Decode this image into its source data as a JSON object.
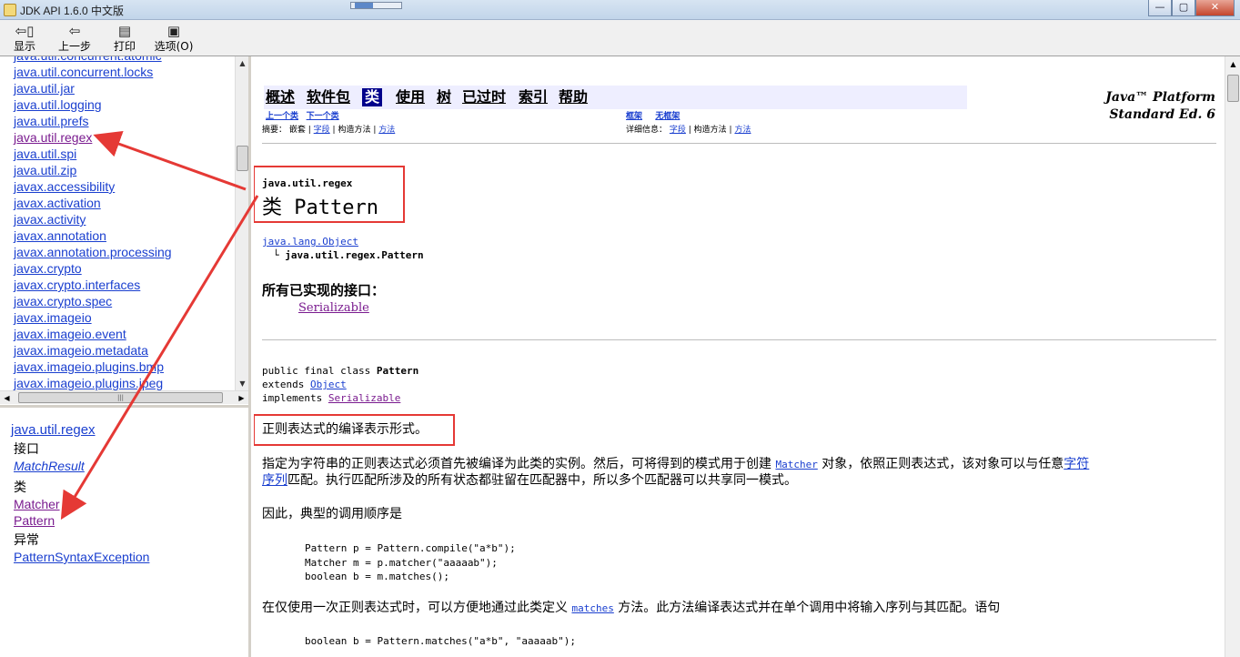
{
  "window": {
    "title": "JDK API 1.6.0 中文版",
    "buttons": {
      "minimize": "—",
      "maximize": "▢",
      "close": "✕"
    }
  },
  "toolbar": {
    "show": "显示",
    "back": "上一步",
    "print": "打印",
    "options": "选项(O)"
  },
  "package_list": {
    "partial_top": "java.util.concurrent.atomic",
    "items": [
      "java.util.concurrent.locks",
      "java.util.jar",
      "java.util.logging",
      "java.util.prefs",
      "java.util.regex",
      "java.util.spi",
      "java.util.zip",
      "javax.accessibility",
      "javax.activation",
      "javax.activity",
      "javax.annotation",
      "javax.annotation.processing",
      "javax.crypto",
      "javax.crypto.interfaces",
      "javax.crypto.spec",
      "javax.imageio",
      "javax.imageio.event",
      "javax.imageio.metadata",
      "javax.imageio.plugins.bmp",
      "javax.imageio.plugins.jpeg"
    ]
  },
  "class_frame": {
    "package": "java.util.regex",
    "interfaces_heading": "接口",
    "interfaces": [
      "MatchResult"
    ],
    "classes_heading": "类",
    "classes": [
      "Matcher",
      "Pattern"
    ],
    "exceptions_heading": "异常",
    "exceptions": [
      "PatternSyntaxException"
    ]
  },
  "nav": {
    "items": [
      "概述",
      "软件包",
      "类",
      "使用",
      "树",
      "已过时",
      "索引",
      "帮助"
    ],
    "active": "类",
    "platform_line1": "Java™ Platform",
    "platform_line2": "Standard Ed. 6",
    "prev_class": "上一个类",
    "next_class": "下一个类",
    "frames": "框架",
    "no_frames": "无框架",
    "summary_label": "摘要：",
    "summary_nested": "嵌套",
    "summary_field": "字段",
    "summary_ctor": "构造方法",
    "summary_method": "方法",
    "detail_label": "详细信息：",
    "detail_field": "字段",
    "detail_ctor": "构造方法",
    "detail_method": "方法"
  },
  "class_doc": {
    "package": "java.util.regex",
    "title": "类 Pattern",
    "hierarchy_parent": "java.lang.Object",
    "hierarchy_child": "java.util.regex.Pattern",
    "interfaces_heading": "所有已实现的接口：",
    "interfaces": "Serializable",
    "decl_line1_prefix": "public final class ",
    "decl_line1_name": "Pattern",
    "decl_line2_prefix": "extends ",
    "decl_line2_link": "Object",
    "decl_line3_prefix": "implements ",
    "decl_line3_link": "Serializable",
    "summary": "正则表达式的编译表示形式。",
    "para1_a": "指定为字符串的正则表达式必须首先被编译为此类的实例。然后，可将得到的模式用于创建 ",
    "para1_link1": "Matcher",
    "para1_b": " 对象，依照正则表达式，该对象可以与任意",
    "para1_link2a": "字符",
    "para1_link2b": "序列",
    "para1_c": "匹配。执行匹配所涉及的所有状态都驻留在匹配器中，所以多个匹配器可以共享同一模式。",
    "para2": "因此，典型的调用顺序是",
    "code1_l1_a": "Pattern p = Pattern.",
    "code1_l1_link": "compile",
    "code1_l1_b": "(\"a*b\");",
    "code1_l2_a": "Matcher m = p.",
    "code1_l2_link": "matcher",
    "code1_l2_b": "(\"aaaaab\");",
    "code1_l3_a": "boolean b = m.",
    "code1_l3_link": "matches",
    "code1_l3_b": "();",
    "para3_a": "在仅使用一次正则表达式时，可以方便地通过此类定义 ",
    "para3_link": "matches",
    "para3_b": " 方法。此方法编译表达式并在单个调用中将输入序列与其匹配。语句",
    "code2": "boolean b = Pattern.matches(\"a*b\", \"aaaaab\");"
  },
  "colors": {
    "link": "#1a3fcf",
    "visited": "#7a1b8f",
    "annotation": "#e53935",
    "nav_active": "#00008b",
    "nav_bg": "#eeeeff"
  }
}
